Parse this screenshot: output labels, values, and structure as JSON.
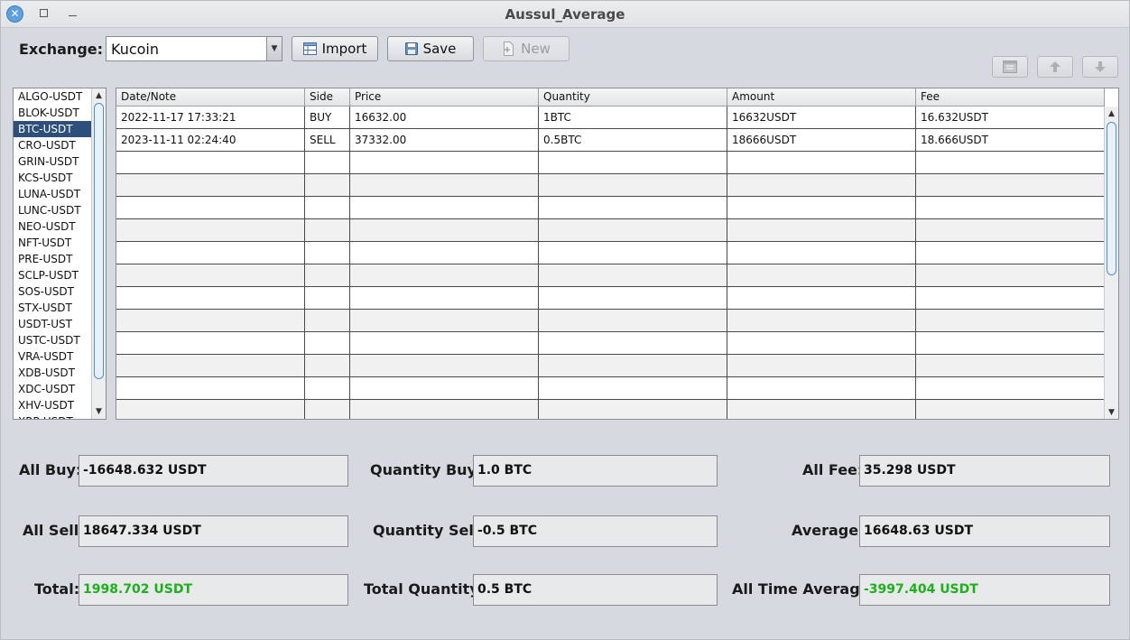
{
  "window": {
    "title": "Aussul_Average"
  },
  "toolbar": {
    "exchange_label": "Exchange:",
    "exchange_value": "Kucoin",
    "import_label": "Import",
    "save_label": "Save",
    "new_label": "New"
  },
  "pairs": {
    "selected": "BTC-USDT",
    "items": [
      "ALGO-USDT",
      "BLOK-USDT",
      "BTC-USDT",
      "CRO-USDT",
      "GRIN-USDT",
      "KCS-USDT",
      "LUNA-USDT",
      "LUNC-USDT",
      "NEO-USDT",
      "NFT-USDT",
      "PRE-USDT",
      "SCLP-USDT",
      "SOS-USDT",
      "STX-USDT",
      "USDT-UST",
      "USTC-USDT",
      "VRA-USDT",
      "XDB-USDT",
      "XDC-USDT",
      "XHV-USDT",
      "XRP-USDT"
    ]
  },
  "table": {
    "columns": [
      "Date/Note",
      "Side",
      "Price",
      "Quantity",
      "Amount",
      "Fee"
    ],
    "rows": [
      [
        "2022-11-17 17:33:21",
        "BUY",
        "16632.00",
        "1BTC",
        "16632USDT",
        "16.632USDT"
      ],
      [
        "2023-11-11 02:24:40",
        "SELL",
        "37332.00",
        "0.5BTC",
        "18666USDT",
        "18.666USDT"
      ]
    ],
    "empty_rows": 12
  },
  "stats": {
    "all_buy_label": "All Buy:",
    "all_buy": "-16648.632 USDT",
    "all_sell_label": "All Sell:",
    "all_sell": "18647.334 USDT",
    "total_label": "Total:",
    "total": "1998.702 USDT",
    "qty_buy_label": "Quantity Buy:",
    "qty_buy": "1.0 BTC",
    "qty_sell_label": "Quantity Sell:",
    "qty_sell": "-0.5 BTC",
    "total_qty_label": "Total Quantity:",
    "total_qty": "0.5 BTC",
    "all_fee_label": "All Fee:",
    "all_fee": "35.298 USDT",
    "average_label": "Average:",
    "average": "16648.63 USDT",
    "all_time_avg_label": "All Time Average:",
    "all_time_avg": "-3997.404 USDT"
  },
  "colors": {
    "positive": "#1db01d",
    "selection": "#2d4f79"
  },
  "icons": {
    "close": "close-icon",
    "maximize": "maximize-icon",
    "minimize": "minimize-icon",
    "import": "table-import-icon",
    "save": "floppy-disk-icon",
    "new": "new-document-icon",
    "calendar": "calendar-icon",
    "move_up": "move-up-icon",
    "move_down": "move-down-icon"
  }
}
